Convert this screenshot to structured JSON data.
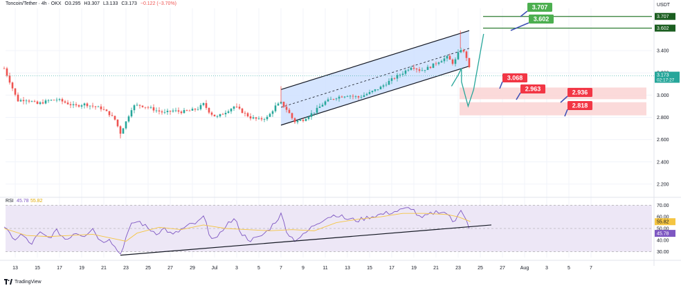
{
  "header": {
    "symbol": "Toncoin/Tether · 4h · OKX",
    "open": "O3.295",
    "high": "H3.307",
    "low": "L3.133",
    "close": "C3.173",
    "change": "−0.122 (−3.70%)"
  },
  "currency": "USDT",
  "brand": "TradingView",
  "colors": {
    "up": "#26a69a",
    "down": "#ef5350",
    "channel_fill": "#cfe0ff",
    "target_green": "#4caf50",
    "target_red": "#f23645",
    "zone_red": "#fbd6d6",
    "rsi": "#7e57c2",
    "rsi_ma": "#f5c542",
    "rsi_band": "#ede7f6"
  },
  "chart_data": [
    {
      "type": "candlestick",
      "pair": "Toncoin/Tether",
      "timeframe": "4h",
      "exchange": "OKX",
      "x_tick_labels": [
        "13",
        "15",
        "17",
        "19",
        "21",
        "23",
        "25",
        "27",
        "29",
        "Jul",
        "3",
        "5",
        "7",
        "9",
        "11",
        "13",
        "15",
        "17",
        "19",
        "21",
        "23",
        "25",
        "27",
        "Aug",
        "3",
        "5",
        "7"
      ],
      "y_tick_labels": [
        "2.200",
        "2.400",
        "2.600",
        "2.800",
        "3.000",
        "3.200",
        "3.400"
      ],
      "ylim": [
        2.1,
        3.78
      ],
      "last_price": {
        "value": "3.173",
        "countdown": "02:17:27"
      },
      "price_line_labels": [
        "3.707",
        "3.602"
      ],
      "target_labels_green": [
        "3.707",
        "3.602"
      ],
      "target_labels_red": [
        "3.068",
        "2.963",
        "2.936",
        "2.818"
      ],
      "key_levels": {
        "resistance": [
          3.707,
          3.602
        ],
        "support_zone_upper": [
          2.963,
          3.068
        ],
        "support_zone_lower": [
          2.818,
          2.936
        ]
      },
      "channel": {
        "start_day": 8,
        "end_day": 25,
        "upper": [
          3.05,
          3.58
        ],
        "lower": [
          2.73,
          3.26
        ]
      },
      "projection_path": [
        [
          23.4,
          3.08
        ],
        [
          24.0,
          3.18
        ],
        [
          24.3,
          3.24
        ],
        [
          24.3,
          3.12
        ],
        [
          24.9,
          2.9
        ],
        [
          25.4,
          3.05
        ],
        [
          26.3,
          3.55
        ]
      ],
      "close_path": [
        [
          12.0,
          3.24
        ],
        [
          12.6,
          3.1
        ],
        [
          13.2,
          2.95
        ],
        [
          14.0,
          2.96
        ],
        [
          15.0,
          2.92
        ],
        [
          16.0,
          2.95
        ],
        [
          16.8,
          2.96
        ],
        [
          17.6,
          2.93
        ],
        [
          18.4,
          2.9
        ],
        [
          19.2,
          2.92
        ],
        [
          20.0,
          2.9
        ],
        [
          20.8,
          2.88
        ],
        [
          21.5,
          2.83
        ],
        [
          22.0,
          2.78
        ],
        [
          22.5,
          2.66
        ],
        [
          23.0,
          2.76
        ],
        [
          23.6,
          2.9
        ],
        [
          24.2,
          2.91
        ],
        [
          25.0,
          2.89
        ],
        [
          25.8,
          2.86
        ],
        [
          26.5,
          2.84
        ],
        [
          27.2,
          2.86
        ],
        [
          28.0,
          2.85
        ],
        [
          28.8,
          2.86
        ],
        [
          29.5,
          2.88
        ],
        [
          30.0,
          2.92
        ],
        [
          30.6,
          2.84
        ],
        [
          31.2,
          2.8
        ],
        [
          32.0,
          2.85
        ],
        [
          32.8,
          2.9
        ],
        [
          33.5,
          2.85
        ],
        [
          34.2,
          2.8
        ],
        [
          35.0,
          2.78
        ],
        [
          35.8,
          2.8
        ],
        [
          36.5,
          2.9
        ],
        [
          37.0,
          2.93
        ],
        [
          37.6,
          2.86
        ],
        [
          38.2,
          2.76
        ],
        [
          39.0,
          2.78
        ],
        [
          40.0,
          2.85
        ],
        [
          41.0,
          2.94
        ],
        [
          42.0,
          2.98
        ],
        [
          43.0,
          3.0
        ],
        [
          44.0,
          2.98
        ],
        [
          45.0,
          3.02
        ],
        [
          46.0,
          3.07
        ],
        [
          47.0,
          3.14
        ],
        [
          48.0,
          3.2
        ],
        [
          48.8,
          3.26
        ],
        [
          49.6,
          3.22
        ],
        [
          50.4,
          3.25
        ],
        [
          51.2,
          3.3
        ],
        [
          52.0,
          3.34
        ],
        [
          52.6,
          3.28
        ],
        [
          53.2,
          3.42
        ],
        [
          53.7,
          3.36
        ],
        [
          54.1,
          3.2
        ]
      ],
      "highs": [
        [
          37.0,
          3.08
        ],
        [
          53.2,
          3.58
        ],
        [
          22.5,
          2.61
        ]
      ]
    },
    {
      "type": "line",
      "indicator": "RSI",
      "label": "RSI",
      "value_text": "45.78",
      "ma_text": "55.82",
      "y_tick_labels": [
        "30.00",
        "40.00",
        "50.00",
        "60.00",
        "70.00"
      ],
      "ylim": [
        25,
        75
      ],
      "value_labels": [
        "55.82",
        "45.78"
      ],
      "trendline": [
        [
          22.5,
          27.0
        ],
        [
          56.0,
          53.0
        ]
      ],
      "rsi_path": [
        [
          12.0,
          52
        ],
        [
          12.8,
          40
        ],
        [
          13.6,
          45
        ],
        [
          14.4,
          36
        ],
        [
          15.2,
          46
        ],
        [
          16.0,
          42
        ],
        [
          16.8,
          48
        ],
        [
          17.6,
          40
        ],
        [
          18.4,
          47
        ],
        [
          19.2,
          44
        ],
        [
          20.0,
          50
        ],
        [
          20.8,
          38
        ],
        [
          21.5,
          42
        ],
        [
          22.0,
          34
        ],
        [
          22.5,
          28
        ],
        [
          23.0,
          42
        ],
        [
          23.6,
          55
        ],
        [
          24.2,
          56
        ],
        [
          25.0,
          50
        ],
        [
          25.8,
          46
        ],
        [
          26.5,
          50
        ],
        [
          27.2,
          44
        ],
        [
          28.0,
          49
        ],
        [
          28.8,
          53
        ],
        [
          29.5,
          55
        ],
        [
          30.0,
          60
        ],
        [
          30.6,
          44
        ],
        [
          31.2,
          40
        ],
        [
          32.0,
          53
        ],
        [
          32.8,
          58
        ],
        [
          33.5,
          45
        ],
        [
          34.2,
          40
        ],
        [
          35.0,
          42
        ],
        [
          35.8,
          48
        ],
        [
          36.5,
          56
        ],
        [
          37.0,
          62
        ],
        [
          37.6,
          46
        ],
        [
          38.2,
          40
        ],
        [
          39.0,
          44
        ],
        [
          40.0,
          53
        ],
        [
          41.0,
          59
        ],
        [
          42.0,
          62
        ],
        [
          43.0,
          58
        ],
        [
          44.0,
          57
        ],
        [
          45.0,
          60
        ],
        [
          46.0,
          62
        ],
        [
          47.0,
          64
        ],
        [
          48.0,
          66
        ],
        [
          48.8,
          68
        ],
        [
          49.6,
          58
        ],
        [
          50.4,
          62
        ],
        [
          51.2,
          65
        ],
        [
          52.0,
          63
        ],
        [
          52.6,
          54
        ],
        [
          53.2,
          68
        ],
        [
          53.7,
          58
        ],
        [
          54.1,
          46
        ]
      ],
      "ma_path": [
        [
          12.0,
          50
        ],
        [
          14.0,
          44
        ],
        [
          16.0,
          43
        ],
        [
          18.0,
          44
        ],
        [
          20.0,
          45
        ],
        [
          22.0,
          41
        ],
        [
          23.0,
          39
        ],
        [
          24.0,
          46
        ],
        [
          26.0,
          51
        ],
        [
          28.0,
          49
        ],
        [
          30.0,
          53
        ],
        [
          32.0,
          50
        ],
        [
          34.0,
          49
        ],
        [
          36.0,
          48
        ],
        [
          38.0,
          49
        ],
        [
          40.0,
          48
        ],
        [
          42.0,
          55
        ],
        [
          44.0,
          58
        ],
        [
          46.0,
          60
        ],
        [
          48.0,
          63
        ],
        [
          50.0,
          63
        ],
        [
          52.0,
          62
        ],
        [
          53.0,
          60
        ],
        [
          54.1,
          56
        ]
      ]
    }
  ]
}
